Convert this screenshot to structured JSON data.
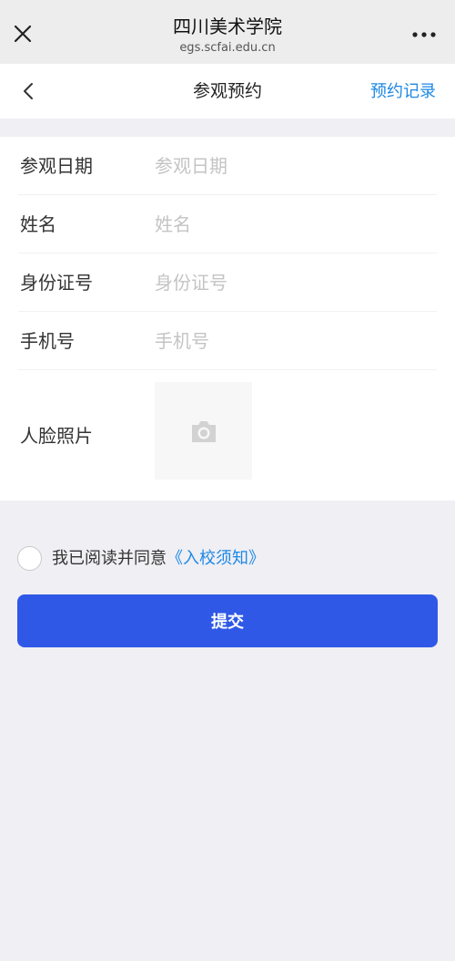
{
  "browser": {
    "title": "四川美术学院",
    "domain": "egs.scfai.edu.cn"
  },
  "header": {
    "title": "参观预约",
    "history_link": "预约记录"
  },
  "form": {
    "fields": [
      {
        "label": "参观日期",
        "placeholder": "参观日期",
        "value": ""
      },
      {
        "label": "姓名",
        "placeholder": "姓名",
        "value": ""
      },
      {
        "label": "身份证号",
        "placeholder": "身份证号",
        "value": ""
      },
      {
        "label": "手机号",
        "placeholder": "手机号",
        "value": ""
      }
    ],
    "photo_label": "人脸照片"
  },
  "agreement": {
    "text": "我已阅读并同意",
    "link": "《入校须知》",
    "checked": false
  },
  "submit_label": "提交",
  "colors": {
    "primary": "#2f58e6",
    "link": "#1e88e5",
    "background": "#efeff4"
  }
}
